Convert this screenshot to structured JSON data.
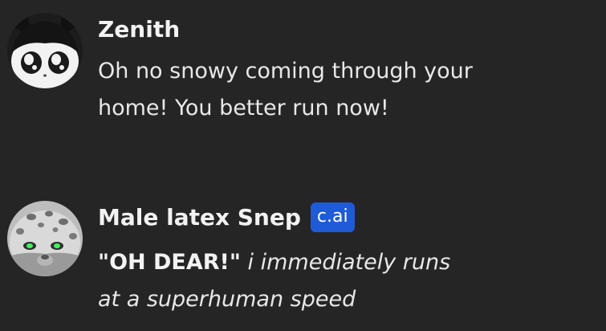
{
  "messages": [
    {
      "author": "Zenith",
      "text_lines": [
        "Oh no snowy coming through your",
        "home! You better run now!"
      ]
    },
    {
      "author": "Male latex Snep",
      "badge": "c.ai",
      "quote": "\"OH DEAR!\"",
      "action_line1": "i immediately runs",
      "action_line2": "at a superhuman speed"
    }
  ],
  "colors": {
    "background": "#252525",
    "text": "#e8e8e8",
    "badge": "#1f5bd6"
  }
}
